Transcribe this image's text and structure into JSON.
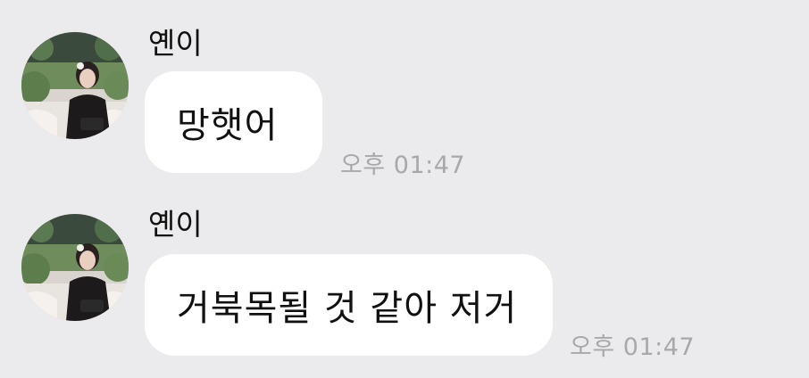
{
  "chat": {
    "messages": [
      {
        "sender": "옌이",
        "text": "망햇어",
        "time": "오후 01:47"
      },
      {
        "sender": "옌이",
        "text": "거북목될 것 같아 저거",
        "time": "오후 01:47"
      }
    ]
  },
  "colors": {
    "background": "#ebebed",
    "bubble": "#ffffff",
    "timestamp": "#a8a8ab"
  },
  "icons": {
    "avatar": "profile-photo"
  }
}
